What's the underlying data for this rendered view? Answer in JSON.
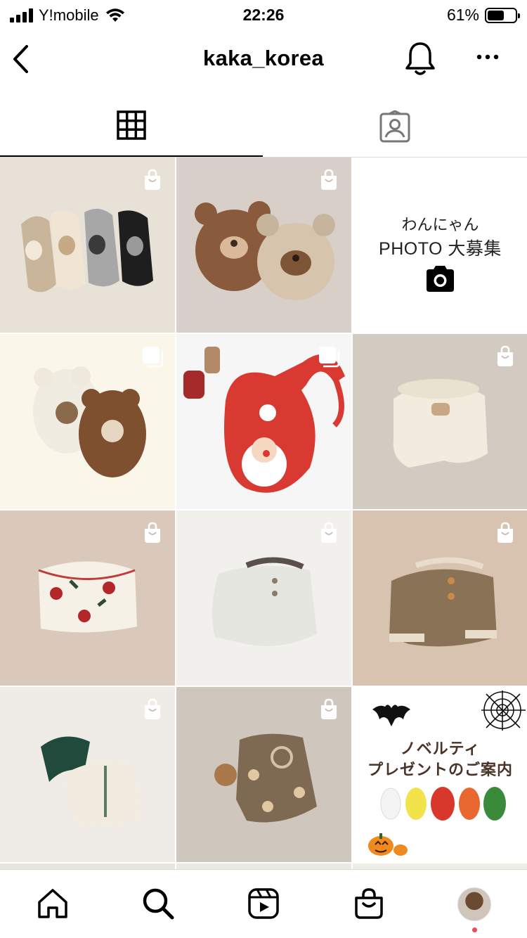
{
  "status_bar": {
    "carrier": "Y!mobile",
    "time": "22:26",
    "battery": "61%",
    "battery_level": 0.61
  },
  "header": {
    "title": "kaka_korea"
  },
  "tabs": [
    {
      "icon": "grid-icon",
      "active": true
    },
    {
      "icon": "tagged-icon",
      "active": false
    }
  ],
  "promo_photo": {
    "line1": "わんにゃん",
    "line2": "PHOTO 大募集"
  },
  "promo_novelty": {
    "line1": "ノベルティ",
    "line2": "プレゼントのご案内"
  },
  "bottom_nav": [
    {
      "icon": "home-icon"
    },
    {
      "icon": "search-icon"
    },
    {
      "icon": "reels-icon"
    },
    {
      "icon": "shop-icon"
    },
    {
      "icon": "profile-avatar"
    }
  ],
  "colors": {
    "accent_dot": "#ed4956",
    "divider": "#dbdbdb"
  }
}
